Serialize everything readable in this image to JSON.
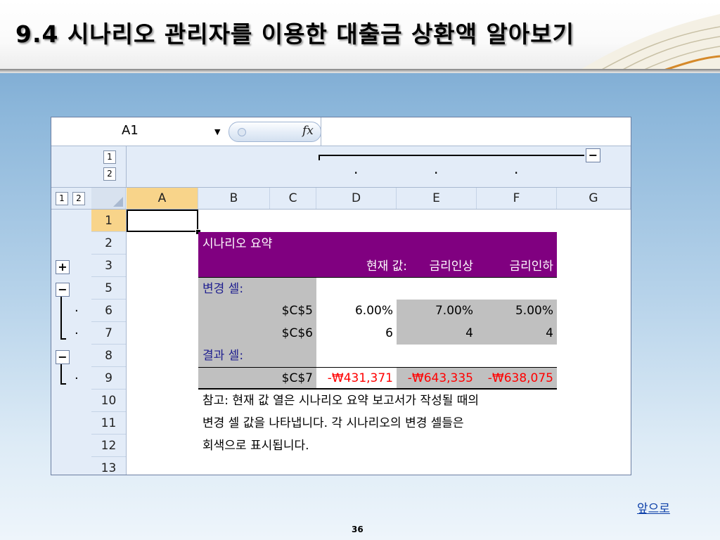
{
  "slide": {
    "title": "9.4 시나리오 관리자를 이용한 대출금 상환액 알아보기",
    "next_link": "앞으로",
    "page_number": "36"
  },
  "excel": {
    "name_box": "A1",
    "fx_label": "fx",
    "outline_levels": [
      "1",
      "2"
    ],
    "outline_dot": "·",
    "collapse_symbol": "−",
    "expand_symbol": "+",
    "columns": [
      "A",
      "B",
      "C",
      "D",
      "E",
      "F",
      "G"
    ],
    "rows": [
      "1",
      "2",
      "3",
      "5",
      "6",
      "7",
      "8",
      "9",
      "10",
      "11",
      "12",
      "13"
    ],
    "active_cell": "A1",
    "summary": {
      "title": "시나리오 요약",
      "header_current": "현재 값:",
      "header_up": "금리인상",
      "header_down": "금리인하",
      "changing_label": "변경 셀:",
      "c5_label": "$C$5",
      "c5_current": "6.00%",
      "c5_up": "7.00%",
      "c5_down": "5.00%",
      "c6_label": "$C$6",
      "c6_current": "6",
      "c6_up": "4",
      "c6_down": "4",
      "result_label": "결과 셀:",
      "c7_label": "$C$7",
      "c7_current": "-₩431,371",
      "c7_up": "-₩643,335",
      "c7_down": "-₩638,075",
      "note_line1": "참고: 현재 값 열은 시나리오 요약 보고서가 작성될 때의",
      "note_line2": "변경 셀 값을 나타냅니다. 각 시나리오의 변경 셀들은",
      "note_line3": "회색으로 표시됩니다."
    }
  },
  "colors": {
    "summary_header": "#800080",
    "changing_cells": "#c0c0c0",
    "negative_values": "#ff0000",
    "active_header": "#f8d48a"
  }
}
